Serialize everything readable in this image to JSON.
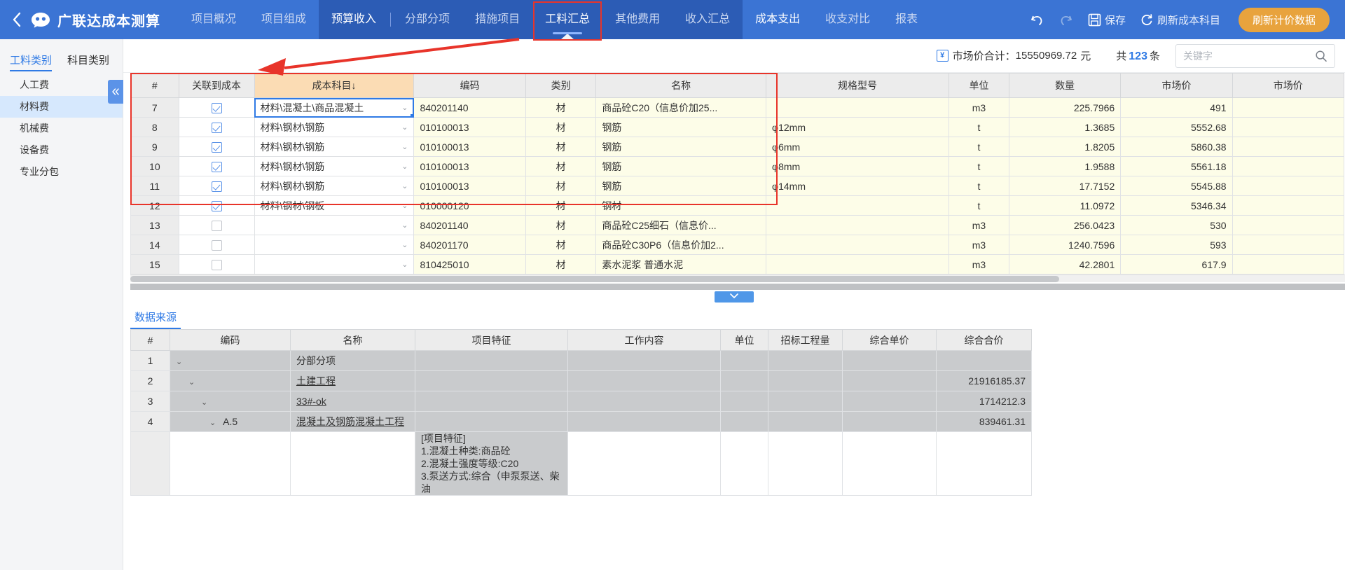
{
  "app": {
    "title": "广联达成本测算",
    "back_icon": "chevron-left-icon",
    "logo_icon": "glodon-logo-icon"
  },
  "nav": {
    "items": [
      {
        "label": "项目概况",
        "state": "normal"
      },
      {
        "label": "项目组成",
        "state": "normal"
      }
    ],
    "group": [
      {
        "label": "预算收入",
        "state": "section-active"
      },
      {
        "label": "分部分项",
        "state": "sub"
      },
      {
        "label": "措施项目",
        "state": "sub"
      },
      {
        "label": "工料汇总",
        "state": "sub-active"
      },
      {
        "label": "其他费用",
        "state": "sub"
      },
      {
        "label": "收入汇总",
        "state": "sub"
      }
    ],
    "tail": [
      {
        "label": "成本支出",
        "state": "normal-white"
      },
      {
        "label": "收支对比",
        "state": "normal"
      },
      {
        "label": "报表",
        "state": "normal"
      }
    ]
  },
  "toolbar": {
    "undo_icon": "undo-icon",
    "redo_icon": "redo-icon",
    "save_icon": "save-icon",
    "save_label": "保存",
    "refresh_icon": "refresh-icon",
    "refresh_label": "刷新成本科目",
    "primary_label": "刷新计价数据",
    "primary_color": "#e8a33d"
  },
  "sidebar": {
    "tabs": [
      {
        "label": "工料类别",
        "active": true
      },
      {
        "label": "科目类别",
        "active": false
      }
    ],
    "items": [
      {
        "label": "人工费",
        "selected": false
      },
      {
        "label": "材料费",
        "selected": true
      },
      {
        "label": "机械费",
        "selected": false
      },
      {
        "label": "设备费",
        "selected": false
      },
      {
        "label": "专业分包",
        "selected": false
      }
    ],
    "collapse_icon": "collapse-left-icon"
  },
  "summary": {
    "money_icon": "money-note-icon",
    "total_label": "市场价合计：",
    "total_value": "15550969.72",
    "unit": "元",
    "count_prefix": "共",
    "count_value": "123",
    "count_suffix": "条"
  },
  "search": {
    "placeholder": "关键字",
    "value": "",
    "icon": "search-icon"
  },
  "grid": {
    "headers": [
      "#",
      "关联到成本",
      "成本科目↓",
      "编码",
      "类别",
      "名称",
      "规格型号",
      "单位",
      "数量",
      "市场价",
      "市场价"
    ],
    "sorted_column": "成本科目↓",
    "rows": [
      {
        "idx": "7",
        "linked": true,
        "account": "材料\\混凝土\\商品混凝土",
        "editing": true,
        "code": "840201140",
        "category": "材",
        "name": "商品砼C20（信息价加25...",
        "spec": "",
        "unit": "m3",
        "qty": "225.7966",
        "price": "491",
        "price2": ""
      },
      {
        "idx": "8",
        "linked": true,
        "account": "材料\\钢材\\钢筋",
        "editing": false,
        "code": "010100013",
        "category": "材",
        "name": "钢筋",
        "spec": "φ12mm",
        "unit": "t",
        "qty": "1.3685",
        "price": "5552.68",
        "price2": ""
      },
      {
        "idx": "9",
        "linked": true,
        "account": "材料\\钢材\\钢筋",
        "editing": false,
        "code": "010100013",
        "category": "材",
        "name": "钢筋",
        "spec": "φ6mm",
        "unit": "t",
        "qty": "1.8205",
        "price": "5860.38",
        "price2": ""
      },
      {
        "idx": "10",
        "linked": true,
        "account": "材料\\钢材\\钢筋",
        "editing": false,
        "code": "010100013",
        "category": "材",
        "name": "钢筋",
        "spec": "φ8mm",
        "unit": "t",
        "qty": "1.9588",
        "price": "5561.18",
        "price2": ""
      },
      {
        "idx": "11",
        "linked": true,
        "account": "材料\\钢材\\钢筋",
        "editing": false,
        "code": "010100013",
        "category": "材",
        "name": "钢筋",
        "spec": "φ14mm",
        "unit": "t",
        "qty": "17.7152",
        "price": "5545.88",
        "price2": ""
      },
      {
        "idx": "12",
        "linked": true,
        "account": "材料\\钢材\\钢板",
        "editing": false,
        "code": "010000120",
        "category": "材",
        "name": "钢材",
        "spec": "",
        "unit": "t",
        "qty": "11.0972",
        "price": "5346.34",
        "price2": ""
      },
      {
        "idx": "13",
        "linked": false,
        "account": "",
        "editing": false,
        "code": "840201140",
        "category": "材",
        "name": "商品砼C25细石（信息价...",
        "spec": "",
        "unit": "m3",
        "qty": "256.0423",
        "price": "530",
        "price2": ""
      },
      {
        "idx": "14",
        "linked": false,
        "account": "",
        "editing": false,
        "code": "840201170",
        "category": "材",
        "name": "商品砼C30P6（信息价加2...",
        "spec": "",
        "unit": "m3",
        "qty": "1240.7596",
        "price": "593",
        "price2": ""
      },
      {
        "idx": "15",
        "linked": false,
        "account": "",
        "editing": false,
        "code": "810425010",
        "category": "材",
        "name": "素水泥浆 普通水泥",
        "spec": "",
        "unit": "m3",
        "qty": "42.2801",
        "price": "617.9",
        "price2": ""
      }
    ]
  },
  "splitter": {
    "icon": "chevron-down-icon"
  },
  "bottom_panel": {
    "tabs": [
      {
        "label": "数据来源",
        "active": true
      }
    ],
    "headers": [
      "#",
      "编码",
      "名称",
      "项目特征",
      "工作内容",
      "单位",
      "招标工程量",
      "综合单价",
      "综合合价"
    ],
    "rows": [
      {
        "idx": "1",
        "indent": 0,
        "expander": "chevron-down-icon",
        "code": "",
        "name": "分部分项",
        "feature": "",
        "work": "",
        "unit": "",
        "qty": "",
        "unit_price": "",
        "total": "",
        "shade": "grey"
      },
      {
        "idx": "2",
        "indent": 1,
        "expander": "chevron-down-icon",
        "code": "",
        "name": "土建工程",
        "feature": "",
        "work": "",
        "unit": "",
        "qty": "",
        "unit_price": "",
        "total": "21916185.37",
        "shade": "grey"
      },
      {
        "idx": "3",
        "indent": 2,
        "expander": "chevron-down-icon",
        "code": "",
        "name": "33#-ok",
        "feature": "",
        "work": "",
        "unit": "",
        "qty": "",
        "unit_price": "",
        "total": "1714212.3",
        "shade": "grey"
      },
      {
        "idx": "4",
        "indent": 3,
        "expander": "chevron-down-icon",
        "code": "A.5",
        "name": "混凝土及钢筋混凝土工程",
        "feature": "",
        "work": "",
        "unit": "",
        "qty": "",
        "unit_price": "",
        "total": "839461.31",
        "shade": "grey"
      },
      {
        "idx": "",
        "indent": 0,
        "expander": "",
        "code": "",
        "name": "",
        "feature": "[项目特征]\n1.混凝土种类:商品砼\n2.混凝土强度等级:C20\n3.泵送方式:综合（申泵泵送、柴油",
        "work": "",
        "unit": "",
        "qty": "",
        "unit_price": "",
        "total": "",
        "shade": "white"
      }
    ]
  },
  "annotations": {
    "nav_highlight": {
      "target": "工料汇总",
      "color": "#e8342a"
    },
    "grid_highlight": {
      "color": "#e8342a",
      "note": "rows 7-12 through 名称 column"
    },
    "arrow": {
      "color": "#e8342a",
      "from": "table-header",
      "to": "nav-item"
    }
  }
}
